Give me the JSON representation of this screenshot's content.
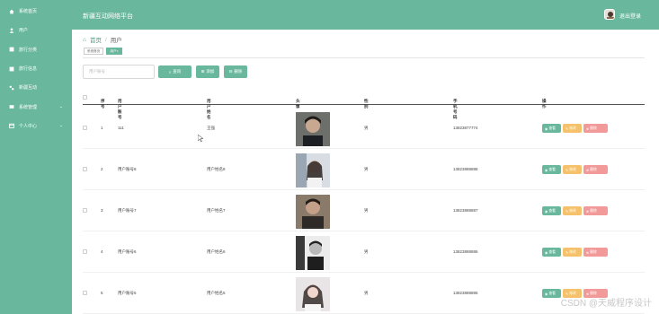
{
  "app": {
    "title": "新疆互动网络平台",
    "logout_label": "退出登录"
  },
  "colors": {
    "primary": "#69b89e",
    "edit": "#f5c26b",
    "delete": "#f29999"
  },
  "sidebar": {
    "items": [
      {
        "label": "系统首页",
        "icon": "home-icon"
      },
      {
        "label": "用户",
        "icon": "user-icon"
      },
      {
        "label": "旅行分类",
        "icon": "category-icon"
      },
      {
        "label": "旅行信息",
        "icon": "info-icon"
      },
      {
        "label": "新疆互动",
        "icon": "interaction-icon"
      },
      {
        "label": "系统管理",
        "icon": "settings-icon",
        "has_submenu": true
      },
      {
        "label": "个人中心",
        "icon": "profile-icon",
        "has_submenu": true
      }
    ]
  },
  "breadcrumb": {
    "home": "首页",
    "separator": "/",
    "current": "用户"
  },
  "tabs": [
    {
      "label": "系统首页"
    },
    {
      "label": "用户×"
    }
  ],
  "search": {
    "placeholder": "用户账号",
    "search_label": "查询",
    "add_label": "添加",
    "delete_label": "删除"
  },
  "table": {
    "headers": {
      "index": "序号",
      "account": "用户账号",
      "name": "用户姓名",
      "avatar": "头像",
      "gender": "性别",
      "phone": "手机号码",
      "actions": "操作"
    },
    "actions": {
      "view": "查看",
      "edit": "修改",
      "delete": "删除"
    },
    "rows": [
      {
        "index": "1",
        "account": "111",
        "name": "王强",
        "gender": "男",
        "phone": "13823877774"
      },
      {
        "index": "2",
        "account": "用户账号8",
        "name": "用户姓名8",
        "gender": "男",
        "phone": "13823888888"
      },
      {
        "index": "3",
        "account": "用户账号7",
        "name": "用户姓名7",
        "gender": "男",
        "phone": "13823888887"
      },
      {
        "index": "4",
        "account": "用户账号6",
        "name": "用户姓名6",
        "gender": "男",
        "phone": "13823888886"
      },
      {
        "index": "5",
        "account": "用户账号5",
        "name": "用户姓名5",
        "gender": "男",
        "phone": "13823888885"
      }
    ]
  },
  "watermark": "CSDN @天威程序设计"
}
